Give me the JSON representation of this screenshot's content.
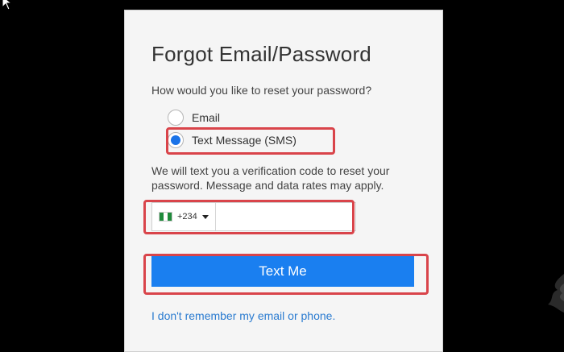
{
  "form": {
    "title": "Forgot Email/Password",
    "question": "How would you like to reset your password?",
    "options": [
      {
        "label": "Email",
        "checked": false
      },
      {
        "label": "Text Message (SMS)",
        "checked": true
      }
    ],
    "description": "We will text you a verification code to reset your password. Message and data rates may apply.",
    "phone": {
      "country_code": "+234",
      "value": "",
      "placeholder": ""
    },
    "submit_label": "Text Me",
    "help_link": "I don't remember my email or phone."
  },
  "colors": {
    "accent": "#1a7ff0",
    "highlight": "#d9444a",
    "link": "#2a7bd0",
    "flag_green": "#1f8a3b"
  }
}
